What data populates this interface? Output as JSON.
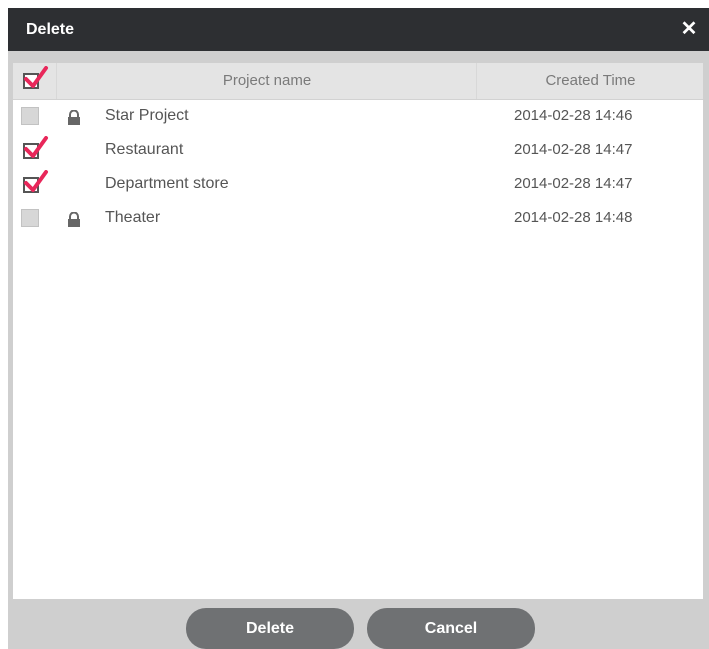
{
  "dialog": {
    "title": "Delete",
    "close_label": "✕",
    "header": {
      "select_all_checked": true,
      "col_name": "Project name",
      "col_time": "Created Time"
    },
    "rows": [
      {
        "checked": false,
        "locked": true,
        "name": "Star Project",
        "time": "2014-02-28 14:46"
      },
      {
        "checked": true,
        "locked": false,
        "name": "Restaurant",
        "time": "2014-02-28 14:47"
      },
      {
        "checked": true,
        "locked": false,
        "name": "Department store",
        "time": "2014-02-28 14:47"
      },
      {
        "checked": false,
        "locked": true,
        "name": "Theater",
        "time": "2014-02-28 14:48"
      }
    ],
    "buttons": {
      "delete_label": "Delete",
      "cancel_label": "Cancel"
    },
    "colors": {
      "titlebar": "#2d2f32",
      "check_mark": "#e8275a",
      "button": "#6f7173"
    }
  }
}
